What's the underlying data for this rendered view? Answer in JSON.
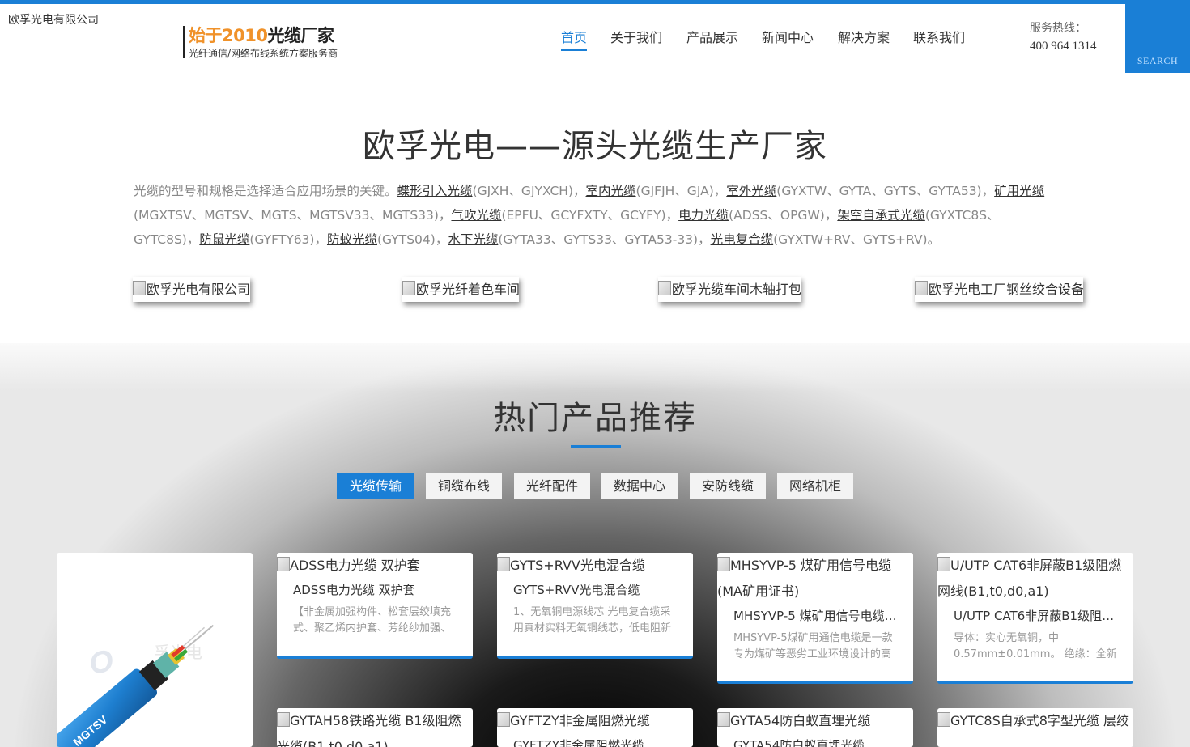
{
  "header": {
    "logo_alt": "欧孚光电有限公司",
    "slogan_accent": "始于2010",
    "slogan_main": "光缆厂家",
    "slogan_sub": "光纤通信/网络布线系统方案服务商",
    "nav": [
      {
        "label": "首页",
        "active": true
      },
      {
        "label": "关于我们"
      },
      {
        "label": "产品展示"
      },
      {
        "label": "新闻中心"
      },
      {
        "label": "解决方案"
      },
      {
        "label": "联系我们"
      }
    ],
    "hotline_label": "服务热线：",
    "hotline_number": "400 964 1314",
    "search_label": "SEARCH"
  },
  "intro": {
    "title": "欧孚光电——源头光缆生产厂家",
    "lead": "光缆的型号和规格是选择适合应用场景的关键。",
    "segments": [
      {
        "link": "蝶形引入光缆",
        "models": "(GJXH、GJYXCH)，"
      },
      {
        "link": "室内光缆",
        "models": "(GJFJH、GJA)，"
      },
      {
        "link": "室外光缆",
        "models": "(GYXTW、GYTA、GYTS、GYTA53)，"
      },
      {
        "link": "矿用光缆",
        "models": "(MGXTSV、MGTSV、MGTS、MGTSV33、MGTS33)，"
      },
      {
        "link": "气吹光缆",
        "models": "(EPFU、GCYFXTY、GCYFY)，"
      },
      {
        "link": "电力光缆",
        "models": "(ADSS、OPGW)，"
      },
      {
        "link": "架空自承式光缆",
        "models": "(GYXTC8S、GYTC8S)，"
      },
      {
        "link": "防鼠光缆",
        "models": "(GYFTY63)，"
      },
      {
        "link": "防蚁光缆",
        "models": "(GYTS04)，"
      },
      {
        "link": "水下光缆",
        "models": "(GYTA33、GYTS33、GYTA53-33)，"
      },
      {
        "link": "光电复合缆",
        "models": "(GYXTW+RV、GYTS+RV)。"
      }
    ],
    "photos": [
      "欧孚光电有限公司",
      "欧孚光纤着色车间",
      "欧孚光缆车间木轴打包",
      "欧孚光电工厂钢丝绞合设备"
    ]
  },
  "products": {
    "title": "热门产品推荐",
    "tabs": [
      {
        "label": "光缆传输",
        "active": true
      },
      {
        "label": "铜缆布线"
      },
      {
        "label": "光纤配件"
      },
      {
        "label": "数据中心"
      },
      {
        "label": "安防线缆"
      },
      {
        "label": "网络机柜"
      }
    ],
    "featured_cable_label": "MGTSV",
    "cards": [
      {
        "img_alt": "ADSS电力光缆 双护套",
        "name": "ADSS电力光缆 双护套",
        "desc": "【非金属加强构件、松套层绞填充式、聚乙烯内护套、芳纶纱加强、"
      },
      {
        "img_alt": "GYTS+RVV光电混合缆",
        "name": "GYTS+RVV光电混合缆",
        "desc": "1、无氧铜电源线芯 光电复合缆采用真材实料无氧铜线芯，低电阻新"
      },
      {
        "img_alt": "MHSYVP-5 煤矿用信号电缆(MA矿用证书)",
        "name": "MHSYVP-5 煤矿用信号电缆(MA矿用证书)",
        "desc": "MHSYVP-5煤矿用通信电缆是一款专为煤矿等恶劣工业环境设计的高"
      },
      {
        "img_alt": "U/UTP CAT6非屏蔽B1级阻燃网线(B1,t0,d0,a1)",
        "name": "U/UTP CAT6非屏蔽B1级阻燃网线(B1,t0,d0,a1)",
        "desc": "导体：实心无氧铜，中0.57mm±0.01mm。 绝缘：全新"
      },
      {
        "img_alt": "GYTAH58铁路光缆 B1级阻燃光缆(B1,t0,d0,a1)",
        "name": "GYTAH58铁路光缆 B1级阻燃光缆",
        "desc": ""
      },
      {
        "img_alt": "GYFTZY非金属阻燃光缆",
        "name": "GYFTZY非金属阻燃光缆",
        "desc": ""
      },
      {
        "img_alt": "GYTA54防白蚁直埋光缆",
        "name": "GYTA54防白蚁直埋光缆",
        "desc": ""
      },
      {
        "img_alt": "GYTC8S自承式8字型光缆 层绞",
        "name": "GYTC8S自承式8字型光缆 层绞",
        "desc": ""
      }
    ]
  }
}
